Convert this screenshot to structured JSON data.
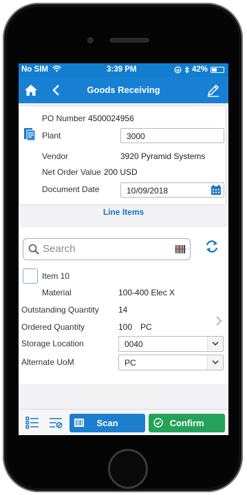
{
  "status_bar": {
    "carrier": "No SIM",
    "time": "3:39 PM",
    "battery_percent": "42%",
    "battery_level": 0.42
  },
  "nav": {
    "title": "Goods Receiving"
  },
  "header": {
    "po_label": "PO Number",
    "po_value": "4500024956",
    "plant_label": "Plant",
    "plant_value": "3000",
    "vendor_label": "Vendor",
    "vendor_value": "3920 Pyramid Systems",
    "net_order_label": "Net Order Value",
    "net_order_value": "200 USD",
    "doc_date_label": "Document Date",
    "doc_date_value": "10/09/2018"
  },
  "line_items_title": "Line Items",
  "search": {
    "placeholder": "Search"
  },
  "item": {
    "title": "Item 10",
    "material_label": "Material",
    "material_value": "100-400 Elec X",
    "outstanding_label": "Outstanding Quantity",
    "outstanding_value": "14",
    "ordered_label": "Ordered Quantity",
    "ordered_value": "100",
    "ordered_unit": "PC",
    "storage_label": "Storage Location",
    "storage_value": "0040",
    "uom_label": "Alternate UoM",
    "uom_value": "PC"
  },
  "toolbar": {
    "scan_label": "Scan",
    "confirm_label": "Confirm"
  },
  "colors": {
    "accent": "#1880d4",
    "confirm": "#23a35a"
  }
}
